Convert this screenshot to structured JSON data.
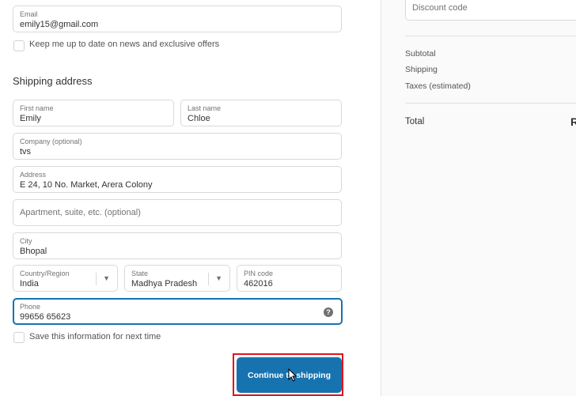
{
  "contact": {
    "email": {
      "label": "Email",
      "value": "emily15@gmail.com"
    },
    "newsletter_label": "Keep me up to date on news and exclusive offers"
  },
  "shipping": {
    "heading": "Shipping address",
    "first_name": {
      "label": "First name",
      "value": "Emily"
    },
    "last_name": {
      "label": "Last name",
      "value": "Chloe"
    },
    "company": {
      "label": "Company (optional)",
      "value": "tvs"
    },
    "address": {
      "label": "Address",
      "value": "E 24, 10 No. Market, Arera Colony"
    },
    "apartment": {
      "placeholder": "Apartment, suite, etc. (optional)"
    },
    "city": {
      "label": "City",
      "value": "Bhopal"
    },
    "country": {
      "label": "Country/Region",
      "value": "India"
    },
    "state": {
      "label": "State",
      "value": "Madhya Pradesh"
    },
    "pin": {
      "label": "PIN code",
      "value": "462016"
    },
    "phone": {
      "label": "Phone",
      "value": "99656 65623"
    },
    "save_label": "Save this information for next time",
    "continue_label": "Continue to shipping"
  },
  "summary": {
    "discount_placeholder": "Discount code",
    "subtotal_label": "Subtotal",
    "shipping_label": "Shipping",
    "taxes_label": "Taxes (estimated)",
    "total_label": "Total",
    "total_value_partial": "R"
  },
  "colors": {
    "accent": "#1773b0",
    "highlight": "#e0141e",
    "border": "#d9d9d9"
  },
  "icons": {
    "help": "question-circle",
    "select": "chevron-down",
    "cursor": "mouse-pointer"
  }
}
